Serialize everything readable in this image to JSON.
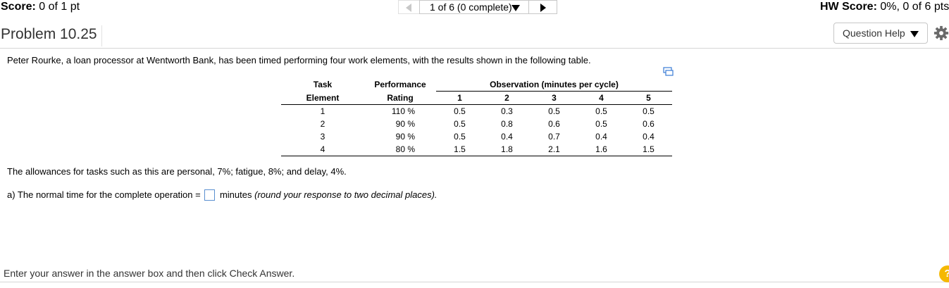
{
  "header": {
    "score_label": "Score:",
    "score_value": "0 of 1 pt",
    "nav_position": "1 of 6 (0 complete)",
    "hw_score_label": "HW Score:",
    "hw_score_value": "0%, 0 of 6 pts"
  },
  "problem": {
    "title": "Problem 10.25",
    "help_button": "Question Help",
    "intro": "Peter Rourke, a loan processor at Wentworth Bank, has been timed performing four work elements, with the results shown in the following table."
  },
  "table": {
    "head": {
      "task_line1": "Task",
      "task_line2": "Element",
      "rating_line1": "Performance",
      "rating_line2": "Rating",
      "observation_head": "Observation (minutes per cycle)",
      "obs_cols": [
        "1",
        "2",
        "3",
        "4",
        "5"
      ]
    },
    "rows": [
      {
        "task": "1",
        "rating": "110 %",
        "obs": [
          "0.5",
          "0.3",
          "0.5",
          "0.5",
          "0.5"
        ]
      },
      {
        "task": "2",
        "rating": "90 %",
        "obs": [
          "0.5",
          "0.8",
          "0.6",
          "0.5",
          "0.6"
        ]
      },
      {
        "task": "3",
        "rating": "90 %",
        "obs": [
          "0.5",
          "0.4",
          "0.7",
          "0.4",
          "0.4"
        ]
      },
      {
        "task": "4",
        "rating": "80 %",
        "obs": [
          "1.5",
          "1.8",
          "2.1",
          "1.6",
          "1.5"
        ]
      }
    ]
  },
  "allowances": "The allowances for tasks such as this are personal, 7%; fatigue, 8%; and delay, 4%.",
  "question_a": {
    "prefix": "a) The normal time for the complete operation =",
    "answer_value": "",
    "suffix": "minutes",
    "note": "(round your response to two decimal places)."
  },
  "footer": {
    "instruction": "Enter your answer in the answer box and then click Check Answer.",
    "help_glyph": "?"
  },
  "colors": {
    "accent_border": "#5a8fd0",
    "help_circle": "#f5b800"
  },
  "icons": [
    "prev-arrow-icon",
    "caret-down-icon",
    "next-arrow-icon",
    "gear-icon",
    "copy-table-icon",
    "help-circle-icon"
  ]
}
